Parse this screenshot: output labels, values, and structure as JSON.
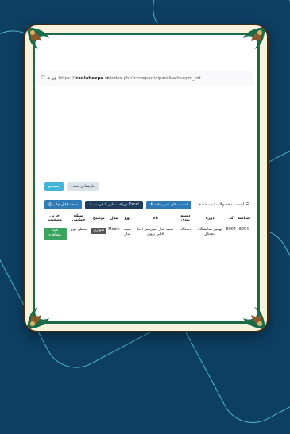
{
  "browser": {
    "url_prefix": "https://",
    "url_host": "iranlabexpo.ir",
    "url_path": "/index.php?ctrl=participant&actn=prc_list"
  },
  "buttons": {
    "search": "جستجو",
    "reset": "بازنشانی مجدد",
    "print": "نسخه قابل چاپ",
    "excel": "دریافت فایل با فرمت Excel",
    "top_items": "لیست های تمیز یافته"
  },
  "list_title": "لیست محصولات ثبت شده:",
  "table": {
    "headers": [
      "شناسه",
      "کد",
      "دوره",
      "دسته بندی",
      "نام",
      "نوع",
      "مدل",
      "توضیح",
      "سطح حمایتی",
      "آخرین وضعیت"
    ],
    "rows": [
      {
        "id": "8004",
        "code": "8004",
        "period": "نهمین نمایشگاه دیجیتال",
        "category": "دستگاه",
        "name": "شبیه ساز آموزشی احیا قلبی ریوی",
        "type": "شبیه ساز",
        "model": "Moein",
        "desc_button": "شواری",
        "support_level": "سطح دوم",
        "status": "تایید مشاهده"
      }
    ]
  },
  "colors": {
    "background": "#0d3f63",
    "frame_green": "#1b6a4a",
    "status_green": "#3aa35d",
    "accent_teal": "#42b6d6"
  }
}
